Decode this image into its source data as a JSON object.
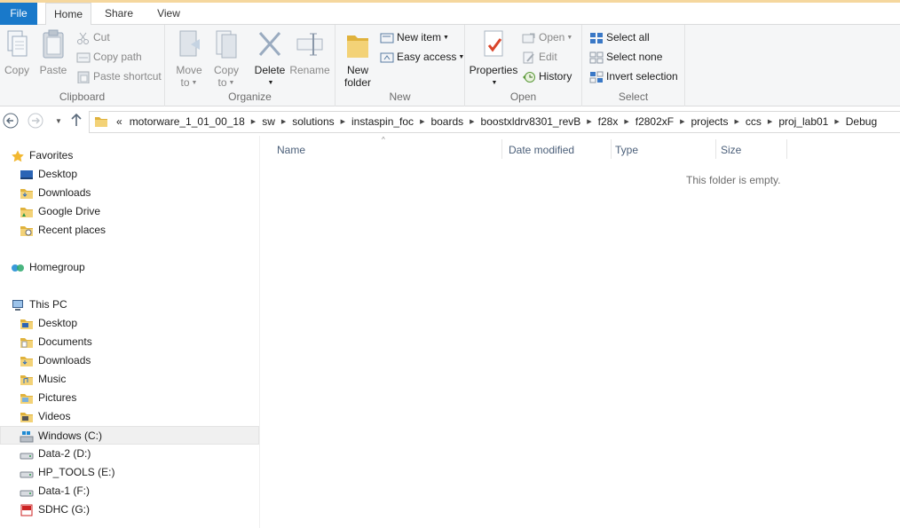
{
  "ribbon_tabs": {
    "file": "File",
    "home": "Home",
    "share": "Share",
    "view": "View"
  },
  "clipboard": {
    "copy": "Copy",
    "paste": "Paste",
    "cut": "Cut",
    "copy_path": "Copy path",
    "paste_shortcut": "Paste shortcut",
    "label": "Clipboard"
  },
  "organize": {
    "move_to_1": "Move",
    "move_to_2": "to",
    "copy_to_1": "Copy",
    "copy_to_2": "to",
    "delete": "Delete",
    "rename": "Rename",
    "label": "Organize"
  },
  "new_group": {
    "new_folder_1": "New",
    "new_folder_2": "folder",
    "new_item": "New item",
    "easy_access": "Easy access",
    "label": "New"
  },
  "open_group": {
    "properties": "Properties",
    "open": "Open",
    "edit": "Edit",
    "history": "History",
    "label": "Open"
  },
  "select_group": {
    "select_all": "Select all",
    "select_none": "Select none",
    "invert_selection": "Invert selection",
    "label": "Select"
  },
  "address": {
    "overflow": "«",
    "crumbs": [
      "motorware_1_01_00_18",
      "sw",
      "solutions",
      "instaspin_foc",
      "boards",
      "boostxldrv8301_revB",
      "f28x",
      "f2802xF",
      "projects",
      "ccs",
      "proj_lab01",
      "Debug"
    ]
  },
  "nav": {
    "favorites": "Favorites",
    "fav_desktop": "Desktop",
    "fav_downloads": "Downloads",
    "fav_google_drive": "Google Drive",
    "fav_recent": "Recent places",
    "homegroup": "Homegroup",
    "this_pc": "This PC",
    "pc_desktop": "Desktop",
    "pc_documents": "Documents",
    "pc_downloads": "Downloads",
    "pc_music": "Music",
    "pc_pictures": "Pictures",
    "pc_videos": "Videos",
    "drive_c": "Windows (C:)",
    "drive_d": "Data-2 (D:)",
    "drive_e": "HP_TOOLS (E:)",
    "drive_f": "Data-1 (F:)",
    "drive_g": "SDHC (G:)"
  },
  "columns": {
    "name": "Name",
    "date": "Date modified",
    "type": "Type",
    "size": "Size"
  },
  "empty_message": "This folder is empty.",
  "colors": {
    "accent": "#1979ca",
    "header_text": "#4c607a",
    "folder": "#e8c14a"
  }
}
